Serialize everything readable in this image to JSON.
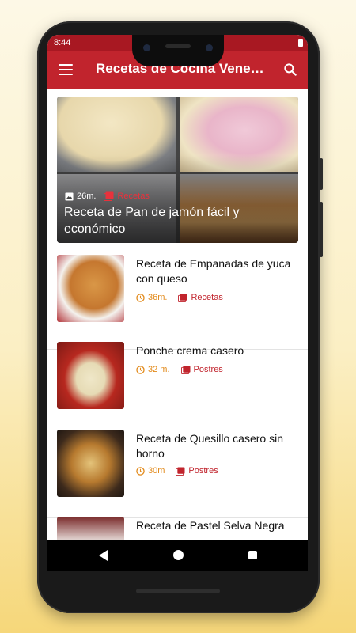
{
  "status_bar": {
    "time": "8:44"
  },
  "app_bar": {
    "title": "Recetas de Cocina Venezolanas"
  },
  "featured": {
    "title": "Receta de Pan de jamón fácil y económico",
    "time": "26m.",
    "category": "Recetas"
  },
  "recipes": [
    {
      "title": "Receta de Empanadas de yuca con queso",
      "time": "36m.",
      "category": "Recetas"
    },
    {
      "title": "Ponche crema casero",
      "time": "32 m.",
      "category": "Postres"
    },
    {
      "title": "Receta de Quesillo casero sin horno",
      "time": "30m",
      "category": "Postres"
    },
    {
      "title": "Receta de Pastel Selva Negra",
      "time": "",
      "category": ""
    }
  ],
  "colors": {
    "primary": "#c1242d",
    "status": "#a81822",
    "time_accent": "#e28a1b"
  }
}
